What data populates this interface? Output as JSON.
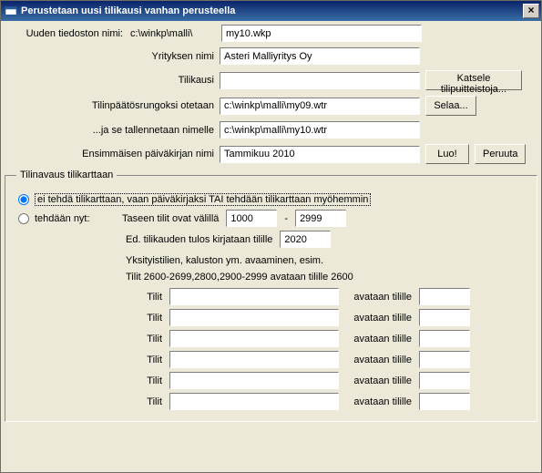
{
  "window": {
    "title": "Perustetaan uusi tilikausi vanhan perusteella"
  },
  "rows": {
    "file_label": "Uuden tiedoston nimi:",
    "file_path_prefix": "c:\\winkp\\malli\\",
    "file_value": "my10.wkp",
    "company_label": "Yrityksen nimi",
    "company_value": "Asteri Malliyritys Oy",
    "period_label": "Tilikausi",
    "period_value": "",
    "templates_btn": "Katsele tilipuitteistoja...",
    "runko_label": "Tilinpäätösrungoksi otetaan",
    "runko_value": "c:\\winkp\\malli\\my09.wtr",
    "browse_btn": "Selaa...",
    "save_label": "...ja se tallennetaan nimelle",
    "save_value": "c:\\winkp\\malli\\my10.wtr",
    "first_label": "Ensimmäisen päiväkirjan nimi",
    "first_value": "Tammikuu 2010",
    "create_btn": "Luo!",
    "cancel_btn": "Peruuta"
  },
  "group": {
    "legend": "Tilinavaus tilikarttaan",
    "opt1": "ei tehdä tilikarttaan, vaan päiväkirjaksi TAI tehdään tilikarttaan myöhemmin",
    "opt2": "tehdään nyt:",
    "range_label": "Taseen tilit ovat välillä",
    "range_from": "1000",
    "range_dash": "-",
    "range_to": "2999",
    "result_label": "Ed. tilikauden tulos kirjataan tilille",
    "result_value": "2020",
    "info1": "Yksityistilien, kaluston ym. avaaminen, esim.",
    "info2": "Tilit 2600-2699,2800,2900-2999 avataan tilille 2600",
    "col_tilit": "Tilit",
    "col_avataan": "avataan tilille",
    "rows": [
      {
        "range": "",
        "target": ""
      },
      {
        "range": "",
        "target": ""
      },
      {
        "range": "",
        "target": ""
      },
      {
        "range": "",
        "target": ""
      },
      {
        "range": "",
        "target": ""
      },
      {
        "range": "",
        "target": ""
      }
    ]
  }
}
